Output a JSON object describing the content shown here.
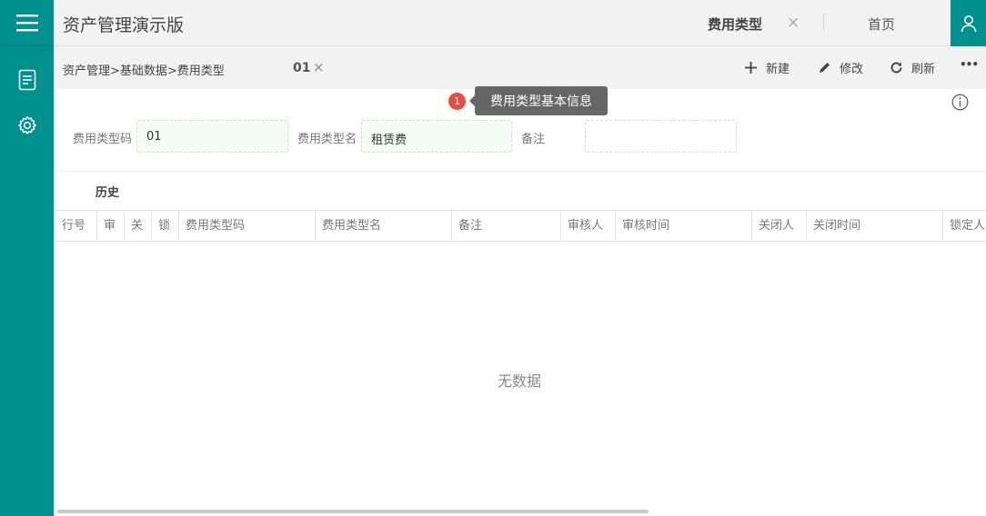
{
  "app": {
    "title": "资产管理演示版"
  },
  "tabs": {
    "active": "费用类型",
    "close": "×",
    "home": "首页"
  },
  "breadcrumb": "资产管理>基础数据>费用类型",
  "record": {
    "id": "01",
    "close": "×"
  },
  "toolbar": {
    "new": "新建",
    "edit": "修改",
    "refresh": "刷新",
    "more": "•••"
  },
  "section": {
    "badge": "1",
    "title": "费用类型基本信息"
  },
  "form": {
    "code_label": "费用类型码",
    "code_value": "01",
    "name_label": "费用类型名",
    "name_value": "租赁费",
    "remark_label": "备注",
    "remark_value": ""
  },
  "history": {
    "title": "历史",
    "columns": [
      "行号",
      "审",
      "关",
      "锁",
      "费用类型码",
      "费用类型名",
      "备注",
      "审核人",
      "审核时间",
      "关闭人",
      "关闭时间",
      "锁定人"
    ],
    "empty_text": "无数据"
  },
  "colors": {
    "brand": "#00908e",
    "badge": "#e74c3c"
  },
  "icons": {
    "menu": "hamburger-icon",
    "doc": "document-icon",
    "settings": "gear-icon",
    "user": "user-icon",
    "info": "info-icon"
  }
}
